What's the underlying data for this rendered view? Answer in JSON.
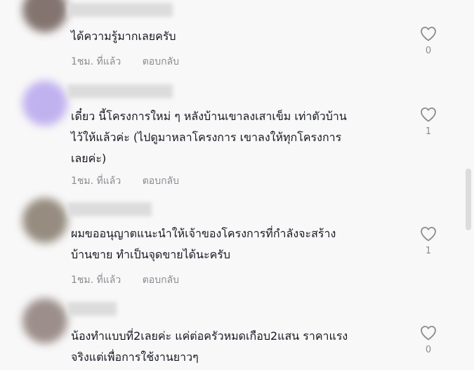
{
  "comments": [
    {
      "text": "ได้ความรู้มากเลยครับ",
      "time": "1ชม. ที่แล้ว",
      "reply": "ตอบกลับ",
      "likes": "0",
      "avatar_color": "#6f5e58"
    },
    {
      "text": "เดี๋ยว นี้โครงการใหม่ ๆ หลังบ้านเขาลงเสาเข็ม เท่าตัวบ้าน\nไว้ให้แล้วค่ะ (ไปดูมาหลาโครงการ เขาลงให้ทุกโครงการ\nเลยค่ะ)",
      "time": "1ชม. ที่แล้ว",
      "reply": "ตอบกลับ",
      "likes": "1",
      "avatar_color": "#b7a6ee"
    },
    {
      "text": "ผมขออนุญาตแนะนำให้เจ้าของโครงการที่กำลังจะสร้าง\nบ้านขาย ทำเป็นจุดขายได้นะครับ",
      "time": "1ชม. ที่แล้ว",
      "reply": "ตอบกลับ",
      "likes": "1",
      "avatar_color": "#857a6a"
    },
    {
      "text": "น้องทำแบบที่2เลยค่ะ แค่ต่อครัวหมดเกือบ2แสน ราคาแรง\nจริงแต่เพื่อการใช้งานยาวๆ",
      "time": "",
      "reply": "",
      "likes": "0",
      "avatar_color": "#8d7d78"
    }
  ]
}
